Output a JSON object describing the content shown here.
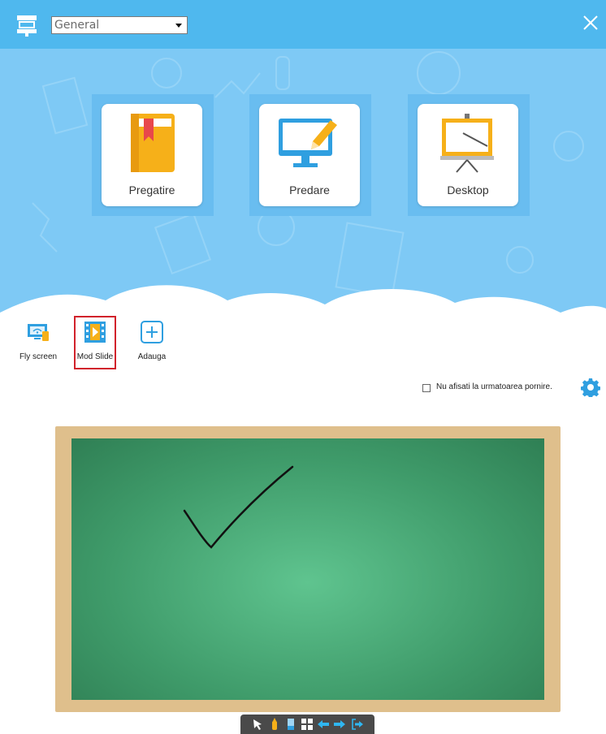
{
  "header": {
    "profile_value": "General",
    "close_icon": "close-icon",
    "app_icon": "board-app-icon"
  },
  "modes": [
    {
      "label": "Pregatire",
      "icon": "book-icon"
    },
    {
      "label": "Predare",
      "icon": "monitor-pen-icon"
    },
    {
      "label": "Desktop",
      "icon": "easel-icon"
    }
  ],
  "quick_apps": [
    {
      "label": "Fly screen",
      "icon": "wifi-screen-icon"
    },
    {
      "label": "Mod Slide",
      "icon": "slide-film-icon",
      "selected": true
    },
    {
      "label": "Adauga",
      "icon": "add-icon"
    }
  ],
  "startup": {
    "checkbox_label": "Nu afisati la urmatoarea pornire.",
    "checked": false
  },
  "toolbar": {
    "icons": [
      "select-arrow-icon",
      "pen-icon",
      "eraser-icon",
      "grid-icon",
      "previous-icon",
      "next-icon",
      "exit-icon"
    ]
  },
  "colors": {
    "header": "#4fb8ee",
    "hero": "#7ec9f5",
    "selection": "#d1222b"
  }
}
